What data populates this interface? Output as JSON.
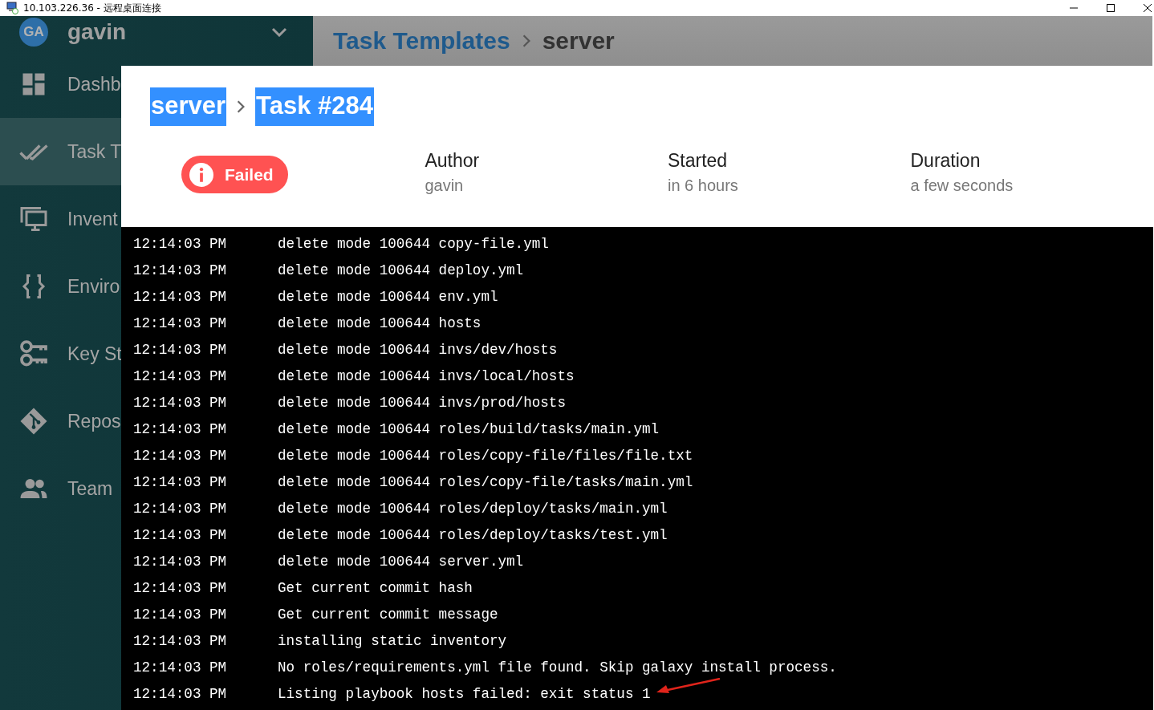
{
  "window": {
    "title": "10.103.226.36 - 远程桌面连接"
  },
  "sidebar": {
    "user": {
      "initials": "GA",
      "name": "gavin"
    },
    "items": [
      {
        "label": "Dashb",
        "selected": false
      },
      {
        "label": "Task T",
        "selected": true
      },
      {
        "label": "Invent",
        "selected": false
      },
      {
        "label": "Enviro",
        "selected": false
      },
      {
        "label": "Key St",
        "selected": false
      },
      {
        "label": "Repos",
        "selected": false
      },
      {
        "label": "Team",
        "selected": false
      }
    ]
  },
  "header": {
    "breadcrumb": [
      "Task Templates",
      "server"
    ]
  },
  "dialog": {
    "breadcrumb": [
      {
        "text": "server",
        "highlighted": true
      },
      {
        "text": "Task #284",
        "highlighted": true
      }
    ],
    "status": "Failed",
    "info": [
      {
        "label": "Author",
        "value": "gavin"
      },
      {
        "label": "Started",
        "value": "in 6 hours"
      },
      {
        "label": "Duration",
        "value": "a few seconds"
      }
    ],
    "log": [
      {
        "time": "12:14:03 PM",
        "message": "delete mode 100644 copy-file.yml"
      },
      {
        "time": "12:14:03 PM",
        "message": "delete mode 100644 deploy.yml"
      },
      {
        "time": "12:14:03 PM",
        "message": "delete mode 100644 env.yml"
      },
      {
        "time": "12:14:03 PM",
        "message": "delete mode 100644 hosts"
      },
      {
        "time": "12:14:03 PM",
        "message": "delete mode 100644 invs/dev/hosts"
      },
      {
        "time": "12:14:03 PM",
        "message": "delete mode 100644 invs/local/hosts"
      },
      {
        "time": "12:14:03 PM",
        "message": "delete mode 100644 invs/prod/hosts"
      },
      {
        "time": "12:14:03 PM",
        "message": "delete mode 100644 roles/build/tasks/main.yml"
      },
      {
        "time": "12:14:03 PM",
        "message": "delete mode 100644 roles/copy-file/files/file.txt"
      },
      {
        "time": "12:14:03 PM",
        "message": "delete mode 100644 roles/copy-file/tasks/main.yml"
      },
      {
        "time": "12:14:03 PM",
        "message": "delete mode 100644 roles/deploy/tasks/main.yml"
      },
      {
        "time": "12:14:03 PM",
        "message": "delete mode 100644 roles/deploy/tasks/test.yml"
      },
      {
        "time": "12:14:03 PM",
        "message": "delete mode 100644 server.yml"
      },
      {
        "time": "12:14:03 PM",
        "message": "Get current commit hash"
      },
      {
        "time": "12:14:03 PM",
        "message": "Get current commit message"
      },
      {
        "time": "12:14:03 PM",
        "message": "installing static inventory"
      },
      {
        "time": "12:14:03 PM",
        "message": "No roles/requirements.yml file found. Skip galaxy install process."
      },
      {
        "time": "12:14:03 PM",
        "message": "Listing playbook hosts failed: exit status 1"
      }
    ]
  },
  "annotation": {
    "kind": "arrow"
  }
}
